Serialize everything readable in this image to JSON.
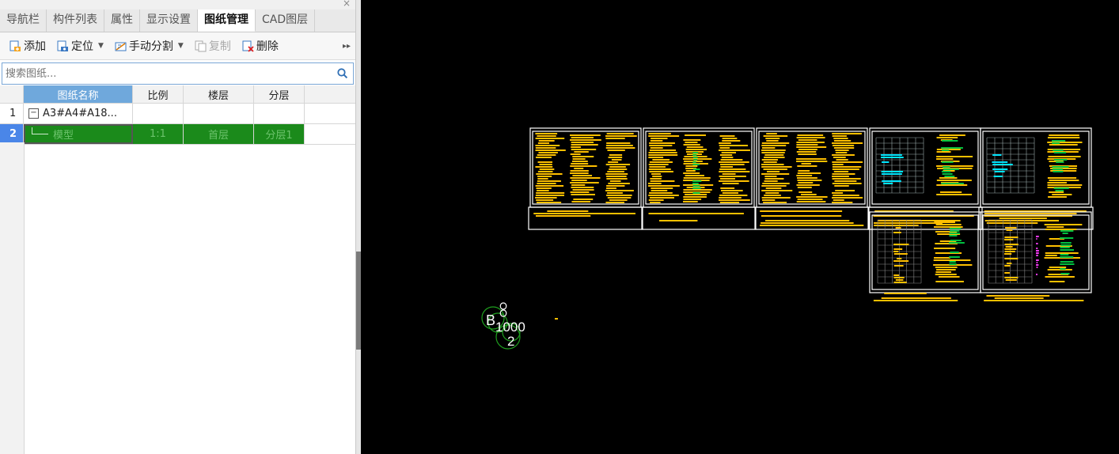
{
  "panel": {
    "close_symbol": "×",
    "tabs": [
      "导航栏",
      "构件列表",
      "属性",
      "显示设置",
      "图纸管理",
      "CAD图层"
    ],
    "active_tab": 4,
    "toolbar": {
      "add": "添加",
      "locate": "定位",
      "manual_split": "手动分割",
      "copy": "复制",
      "delete": "删除"
    },
    "search": {
      "placeholder": "搜索图纸..."
    },
    "table": {
      "headers": [
        "图纸名称",
        "比例",
        "楼层",
        "分层"
      ],
      "rows": [
        {
          "index": "1",
          "name": "A3#A4#A18...",
          "scale": "",
          "floor": "",
          "layer": "",
          "expander": "−"
        },
        {
          "index": "2",
          "name": "模型",
          "scale": "1:1",
          "floor": "首层",
          "layer": "分层1"
        }
      ]
    }
  },
  "canvas": {
    "background": "#000000",
    "accent_colors": {
      "drawing": "#ffc000",
      "frame": "#ffffff",
      "cyan": "#00e5ff",
      "green": "#00c040",
      "magenta": "#ff3cff"
    },
    "marker_labels": {
      "a": "B",
      "b": "1000",
      "c": "2"
    }
  },
  "colors": {
    "selected_row": "#1b8a1b",
    "header_active": "#6fa8dc",
    "row_index_selected": "#4a86e8"
  }
}
